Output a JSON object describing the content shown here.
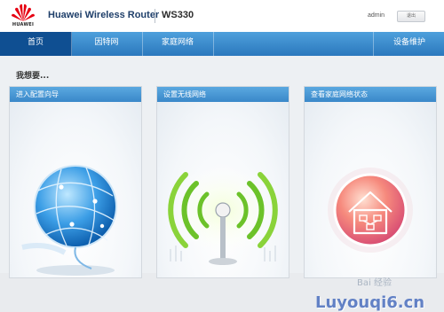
{
  "header": {
    "logo_text": "HUAWEI",
    "product_name": "Huawei Wireless Router",
    "model": "WS330",
    "user": "admin",
    "logout_label": "退出"
  },
  "nav": {
    "items": [
      {
        "label": "首页",
        "active": true
      },
      {
        "label": "因特网",
        "active": false
      },
      {
        "label": "家庭网络",
        "active": false
      },
      {
        "label": "设备维护",
        "active": false
      }
    ]
  },
  "main": {
    "section_title": "我想要...",
    "cards": [
      {
        "title": "进入配置向导",
        "icon": "globe-icon"
      },
      {
        "title": "设置无线网络",
        "icon": "wifi-antenna-icon"
      },
      {
        "title": "查看家庭网络状态",
        "icon": "home-network-icon"
      }
    ]
  },
  "watermark": {
    "text": "Luyouqi6.cn",
    "subtext": "Bai 经验"
  },
  "colors": {
    "nav_gradient_top": "#4ea0dc",
    "nav_active": "#0f4f92",
    "card_header": "#3a88c9",
    "brand_red": "#e60012"
  }
}
